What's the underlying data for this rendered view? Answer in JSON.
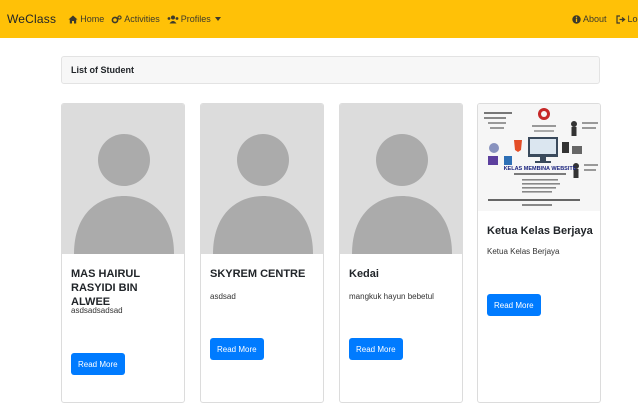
{
  "navbar": {
    "brand": "WeClass",
    "links": [
      {
        "label": "Home",
        "icon": "home-icon"
      },
      {
        "label": "Activities",
        "icon": "cogs-icon"
      },
      {
        "label": "Profiles",
        "icon": "users-icon"
      }
    ],
    "right_links": [
      {
        "label": "About",
        "icon": "info-circle-icon"
      },
      {
        "label": "Logout",
        "icon": "sign-out-icon"
      }
    ],
    "bg_color": "#ffc107"
  },
  "list_header": {
    "title": "List of Student"
  },
  "cards": [
    {
      "title": "MAS HAIRUL RASYIDI BIN ALWEE",
      "text": "asdsadsadsad",
      "button": "Read More",
      "image": "avatar-placeholder"
    },
    {
      "title": "SKYREM CENTRE",
      "text": "asdsad",
      "button": "Read More",
      "image": "avatar-placeholder"
    },
    {
      "title": "Kedai",
      "text": "mangkuk hayun bebetul",
      "button": "Read More",
      "image": "avatar-placeholder"
    },
    {
      "title": "Ketua Kelas Berjaya",
      "text": "Ketua Kelas Berjaya",
      "button": "Read More",
      "image": "poster-image"
    }
  ],
  "poster": {
    "headline": "KELAS MEMBINA WEBSITE"
  },
  "colors": {
    "primary": "#007bff",
    "placeholder_bg": "#dcdcdc",
    "placeholder_fg": "#ababab"
  }
}
